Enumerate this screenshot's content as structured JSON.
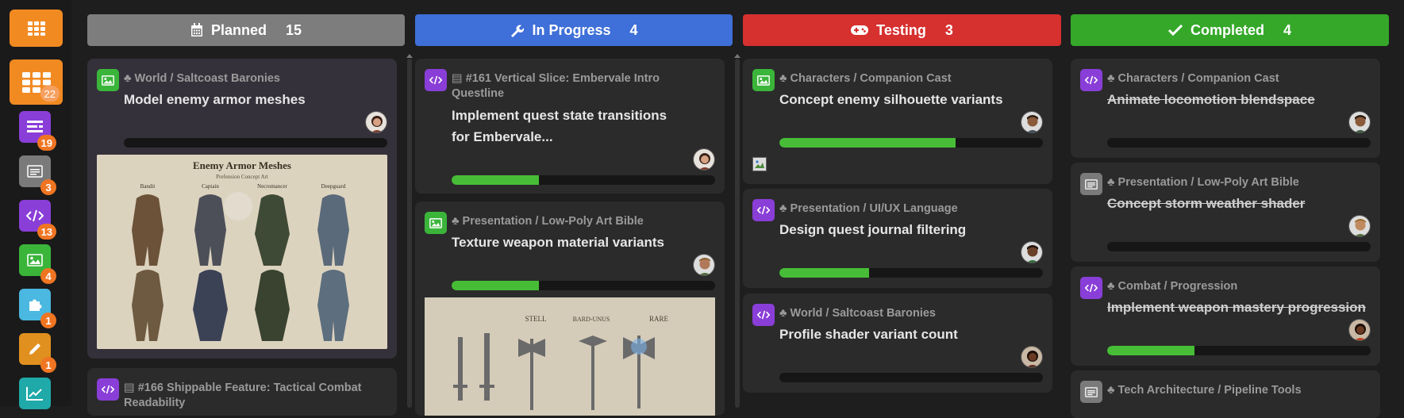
{
  "sidebar": {
    "items": [
      {
        "icon": "board-icon",
        "badge": "22",
        "color": "#f28a22"
      },
      {
        "icon": "epic-icon",
        "badge": "19",
        "color": "#8a3ed8"
      },
      {
        "icon": "document-icon",
        "badge": "3",
        "color": "#7a7a7a"
      },
      {
        "icon": "code-icon",
        "badge": "13",
        "color": "#8a3ed8"
      },
      {
        "icon": "image-icon",
        "badge": "4",
        "color": "#3ab53a"
      },
      {
        "icon": "puzzle-icon",
        "badge": "1",
        "color": "#4ab8e0"
      },
      {
        "icon": "pencil-icon",
        "badge": "1",
        "color": "#e0901e"
      },
      {
        "icon": "chart-icon",
        "badge": "",
        "color": "#1fa9a9"
      }
    ]
  },
  "columns": [
    {
      "label": "Planned",
      "count": "15",
      "color": "#7d7d7d",
      "icon": "calendar-icon"
    },
    {
      "label": "In Progress",
      "count": "4",
      "color": "#3f6fd8",
      "icon": "wrench-icon"
    },
    {
      "label": "Testing",
      "count": "3",
      "color": "#d6302f",
      "icon": "gamepad-icon"
    },
    {
      "label": "Completed",
      "count": "4",
      "color": "#35a82a",
      "icon": "check-icon"
    }
  ],
  "cards": {
    "planned": [
      {
        "type": "image-icon",
        "crumb": "World / Saltcoast Baronies",
        "title": "Model enemy armor meshes",
        "progress": 0,
        "art": {
          "title": "Enemy Armor Meshes",
          "subtitle": "Prefension Concept Art",
          "labels": [
            "Bandit",
            "Captain",
            "Necromancer",
            "Deepguard"
          ]
        }
      },
      {
        "type": "code-icon",
        "crumb": "#166 Shippable Feature: Tactical Combat Readability",
        "title": ""
      }
    ],
    "in_progress": [
      {
        "type": "code-icon",
        "crumb": "#161 Vertical Slice: Embervale Intro Questline",
        "title": "Implement quest state transitions for Embervale...",
        "progress": 0.33
      },
      {
        "type": "image-icon",
        "crumb": "Presentation / Low-Poly Art Bible",
        "title": "Texture weapon material variants",
        "progress": 0.33,
        "art": {
          "labels": [
            "STELL",
            "BARD-UNUS",
            "RARE"
          ]
        }
      }
    ],
    "testing": [
      {
        "type": "image-icon",
        "crumb": "Characters / Companion Cast",
        "title": "Concept enemy silhouette variants",
        "progress": 0.67
      },
      {
        "type": "code-icon",
        "crumb": "Presentation / UI/UX Language",
        "title": "Design quest journal filtering",
        "progress": 0.34
      },
      {
        "type": "code-icon",
        "crumb": "World / Saltcoast Baronies",
        "title": "Profile shader variant count",
        "progress": 0
      }
    ],
    "completed": [
      {
        "type": "code-icon",
        "crumb": "Characters / Companion Cast",
        "title": "Animate locomotion blendspace",
        "progress": 0
      },
      {
        "type": "document-icon",
        "crumb": "Presentation / Low-Poly Art Bible",
        "title": "Concept storm weather shader",
        "progress": 0
      },
      {
        "type": "code-icon",
        "crumb": "Combat / Progression",
        "title": "Implement weapon mastery progression",
        "progress": 0.33
      },
      {
        "type": "document-icon",
        "crumb": "Tech Architecture / Pipeline Tools",
        "title": ""
      }
    ]
  }
}
